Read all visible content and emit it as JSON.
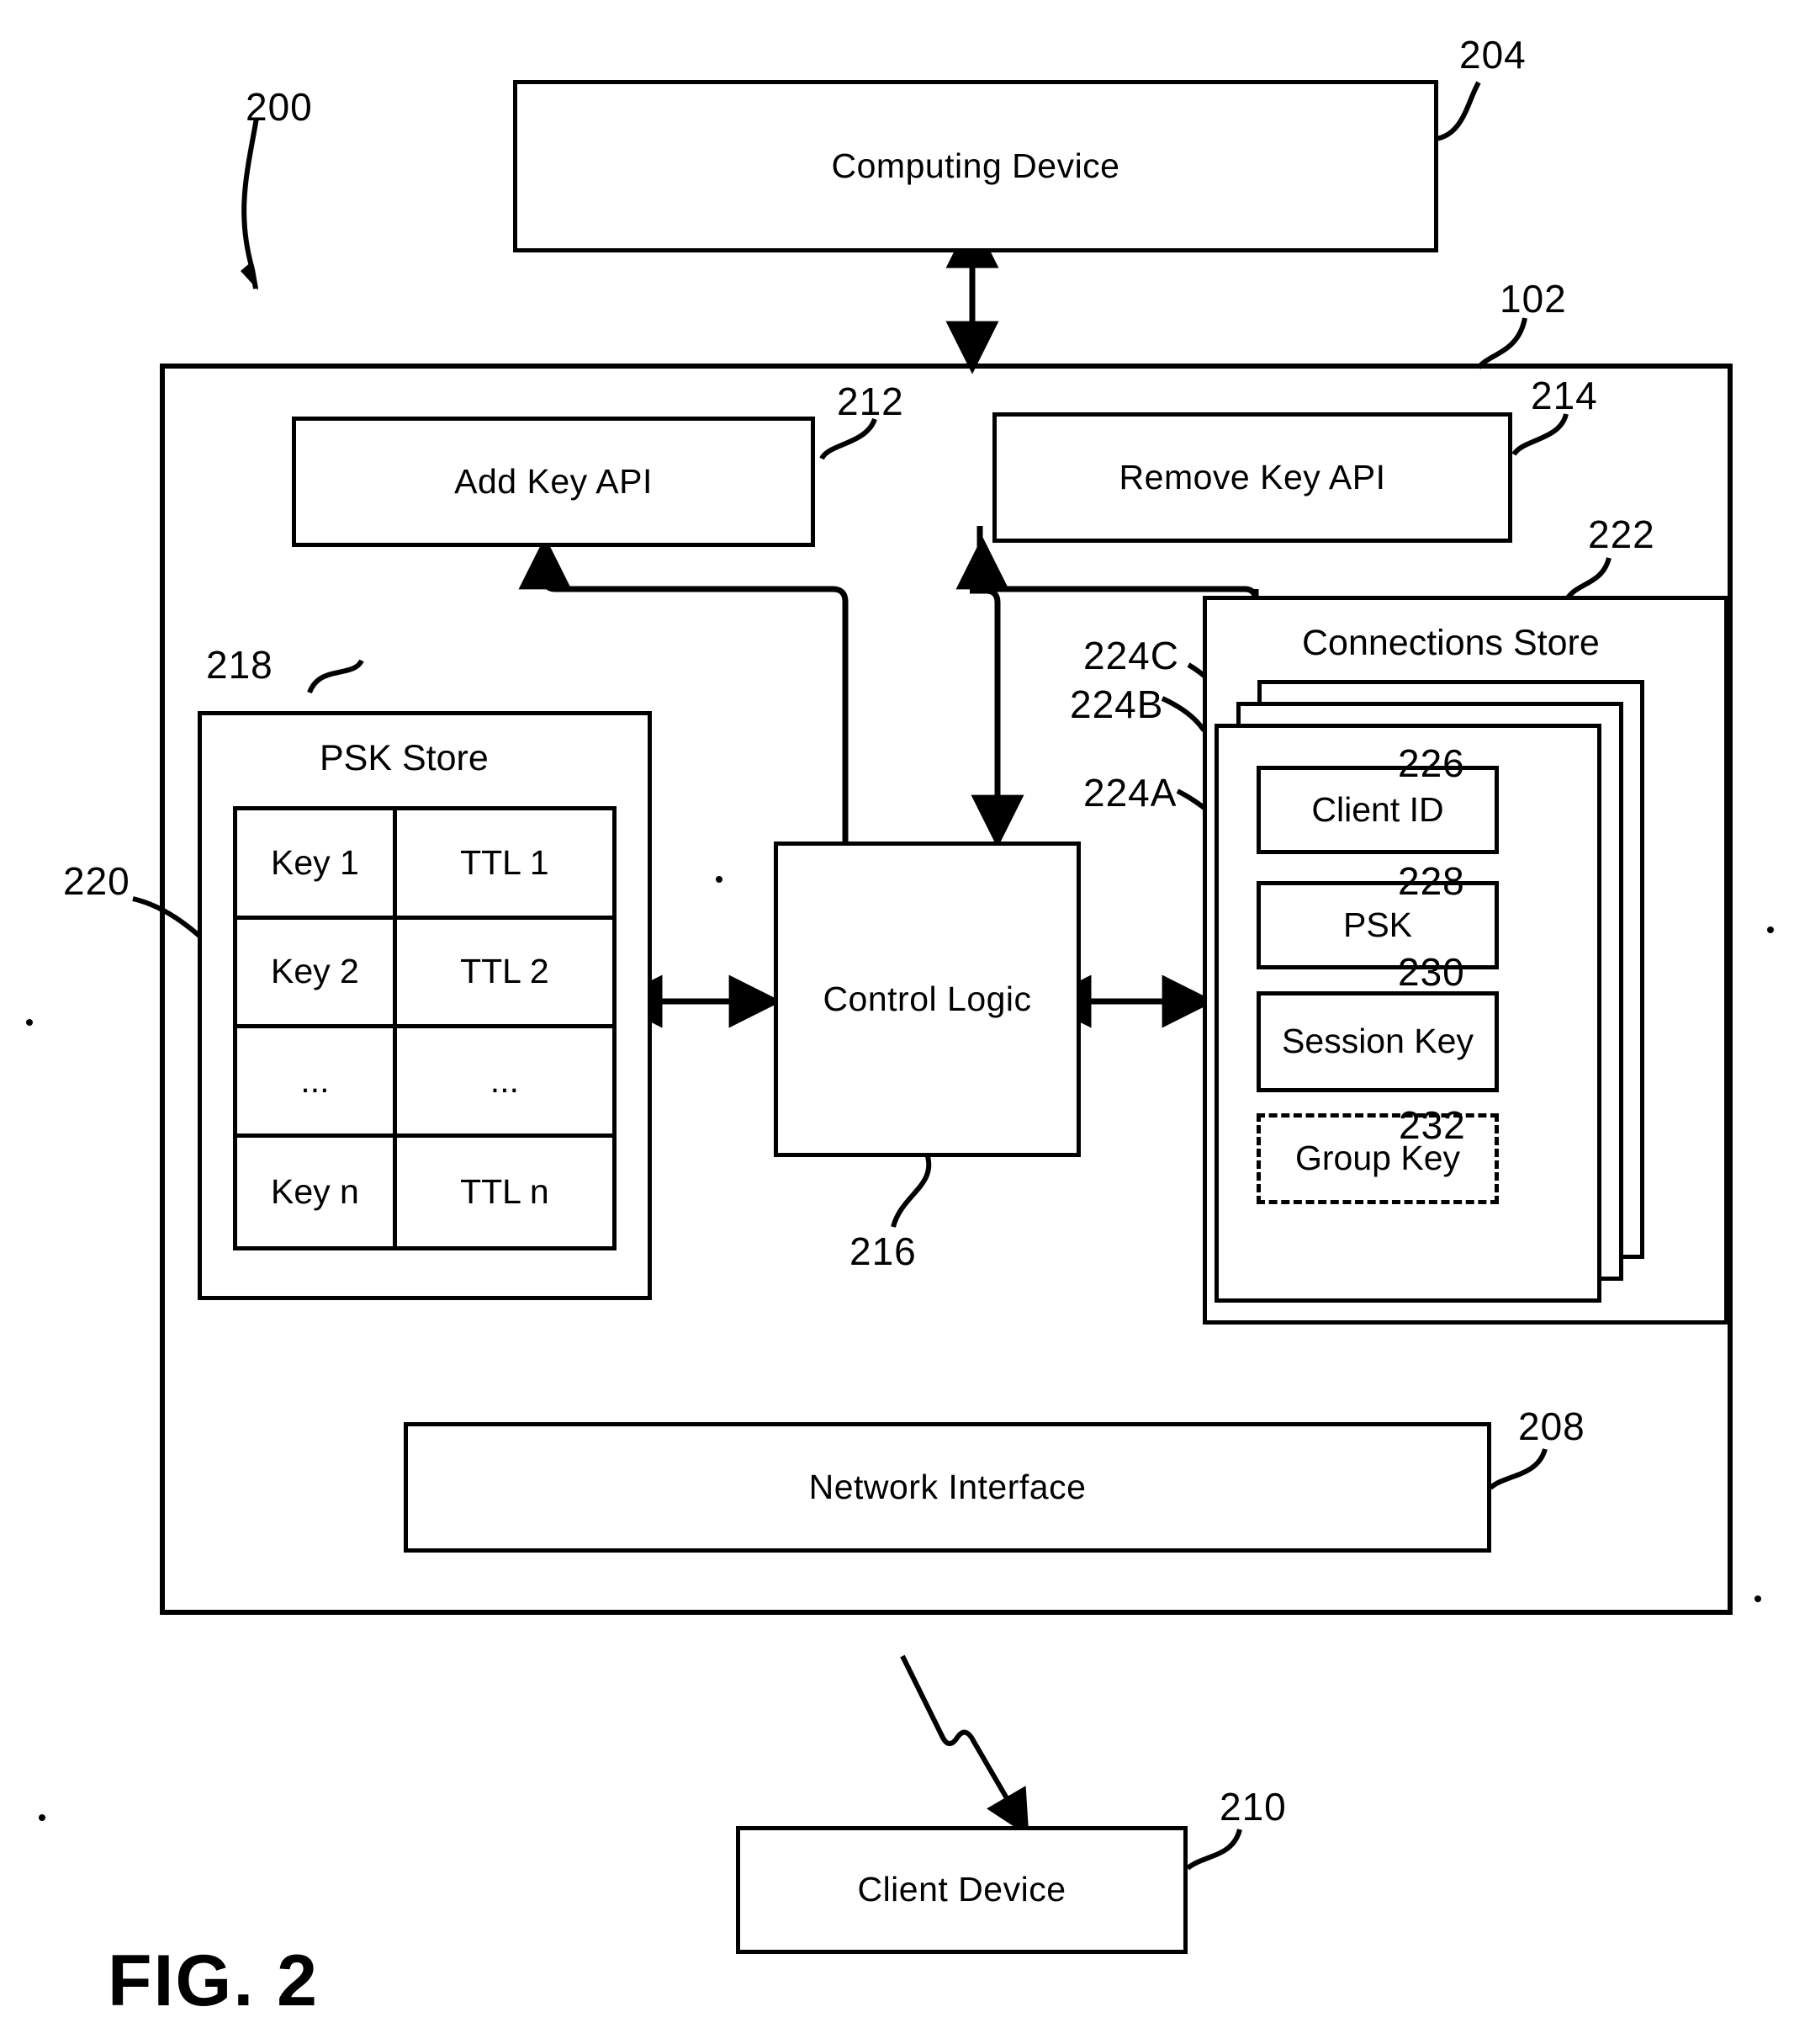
{
  "figure": {
    "caption": "FIG. 2",
    "system_ref": "200"
  },
  "nodes": {
    "computing_device": {
      "label": "Computing Device",
      "ref": "204"
    },
    "server": {
      "ref": "102"
    },
    "add_key_api": {
      "label": "Add Key API",
      "ref": "212"
    },
    "remove_key_api": {
      "label": "Remove Key API",
      "ref": "214"
    },
    "psk_store": {
      "label": "PSK Store",
      "ref": "218",
      "row_ref": "220"
    },
    "control_logic": {
      "label": "Control Logic",
      "ref": "216"
    },
    "connections_store": {
      "label": "Connections Store",
      "ref": "222"
    },
    "network_interface": {
      "label": "Network Interface",
      "ref": "208"
    },
    "client_device": {
      "label": "Client Device",
      "ref": "210"
    }
  },
  "psk_table": {
    "rows": [
      {
        "key": "Key 1",
        "ttl": "TTL 1"
      },
      {
        "key": "Key 2",
        "ttl": "TTL 2"
      },
      {
        "key": "...",
        "ttl": "..."
      },
      {
        "key": "Key n",
        "ttl": "TTL n"
      }
    ]
  },
  "connection_records": {
    "refs": {
      "front": "224A",
      "middle": "224B",
      "back": "224C"
    },
    "fields": [
      {
        "label": "Client ID",
        "ref": "226",
        "style": "solid"
      },
      {
        "label": "PSK",
        "ref": "228",
        "style": "solid"
      },
      {
        "label": "Session Key",
        "ref": "230",
        "style": "solid"
      },
      {
        "label": "Group Key",
        "ref": "232",
        "style": "dashed"
      }
    ]
  },
  "colors": {
    "stroke": "#000000",
    "background": "#ffffff"
  }
}
